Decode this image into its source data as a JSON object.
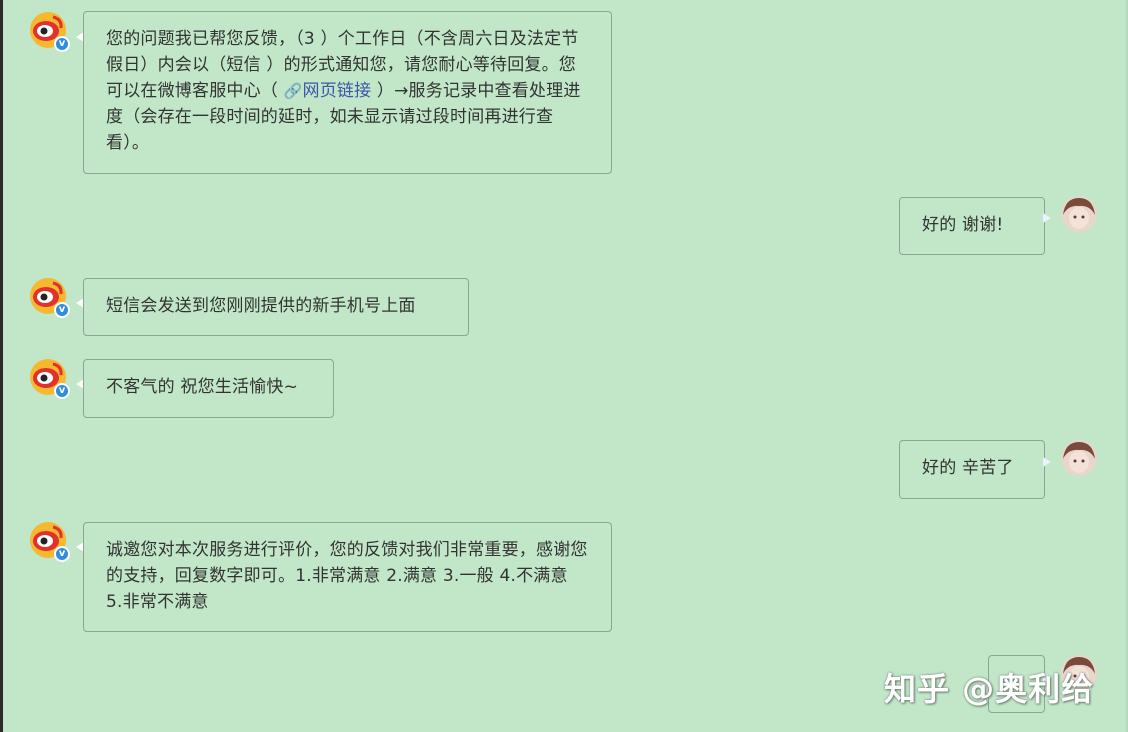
{
  "messages": [
    {
      "side": "left",
      "parts": {
        "before": "您的问题我已帮您反馈，（3 ）个工作日（不含周六日及法定节假日）内会以（短信 ）的形式通知您，请您耐心等待回复。您可以在微博客服中心（ ",
        "link_icon": "link-icon",
        "link_text": "网页链接",
        "after": " ）→服务记录中查看处理进度（会存在一段时间的延时，如未显示请过段时间再进行查看）。"
      }
    },
    {
      "side": "right",
      "text": "好的 谢谢!"
    },
    {
      "side": "left",
      "text": "短信会发送到您刚刚提供的新手机号上面"
    },
    {
      "side": "left",
      "text": "不客气的 祝您生活愉快~"
    },
    {
      "side": "right",
      "text": "好的 辛苦了"
    },
    {
      "side": "left",
      "text": "诚邀您对本次服务进行评价，您的反馈对我们非常重要，感谢您的支持，回复数字即可。1.非常满意 2.满意 3.一般 4.不满意 5.非常不满意"
    },
    {
      "side": "right",
      "text": ""
    }
  ],
  "badge_symbol": "v",
  "watermark": "知乎 @奥利给",
  "colors": {
    "background": "#c1e6c8",
    "bubble_border": "#8ea496",
    "link": "#3d57a8",
    "badge": "#2e8de0"
  }
}
